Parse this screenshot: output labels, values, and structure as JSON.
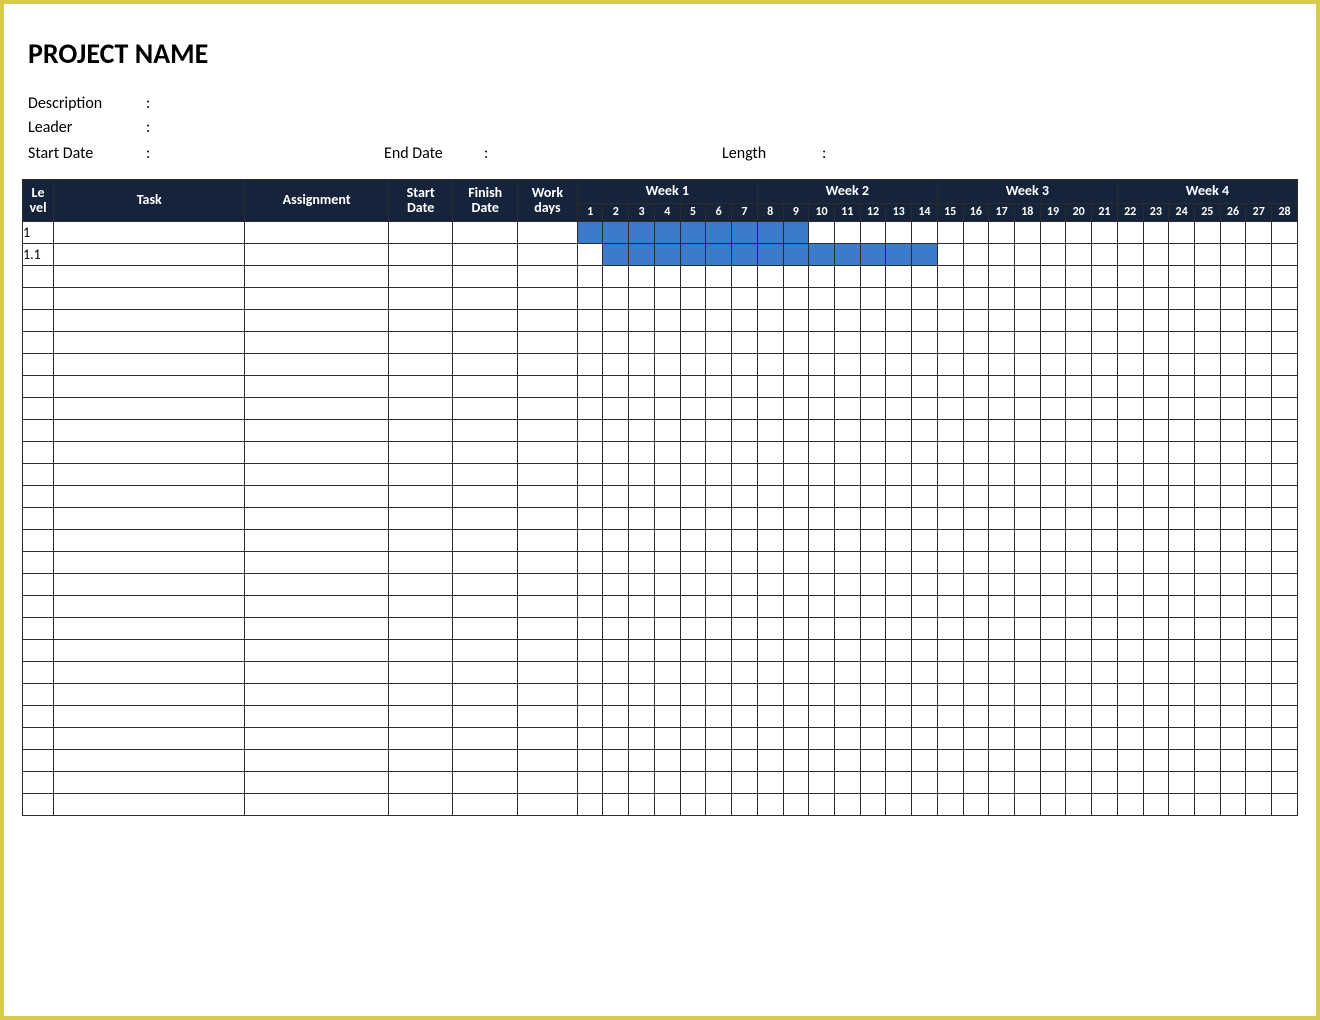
{
  "title": "PROJECT NAME",
  "meta": {
    "description_label": "Description",
    "leader_label": "Leader",
    "start_date_label": "Start Date",
    "end_date_label": "End Date",
    "length_label": "Length",
    "colon": ":"
  },
  "columns": {
    "level": "Le\nvel",
    "task": "Task",
    "assignment": "Assignment",
    "start_date": "Start\nDate",
    "finish_date": "Finish\nDate",
    "work_days": "Work\ndays",
    "weeks": [
      "Week 1",
      "Week 2",
      "Week 3",
      "Week 4"
    ],
    "days": [
      "1",
      "2",
      "3",
      "4",
      "5",
      "6",
      "7",
      "8",
      "9",
      "10",
      "11",
      "12",
      "13",
      "14",
      "15",
      "16",
      "17",
      "18",
      "19",
      "20",
      "21",
      "22",
      "23",
      "24",
      "25",
      "26",
      "27",
      "28"
    ]
  },
  "rows": [
    {
      "level": "1",
      "bar_start": 1,
      "bar_end": 9
    },
    {
      "level": "1.1",
      "bar_start": 2,
      "bar_end": 14
    },
    {},
    {},
    {},
    {},
    {},
    {},
    {},
    {},
    {},
    {},
    {},
    {},
    {},
    {},
    {},
    {},
    {},
    {},
    {},
    {},
    {},
    {},
    {},
    {},
    {}
  ],
  "chart_data": {
    "type": "gantt",
    "title": "PROJECT NAME",
    "x_unit": "day",
    "x_range": [
      1,
      28
    ],
    "groups": [
      "Week 1",
      "Week 2",
      "Week 3",
      "Week 4"
    ],
    "tasks": [
      {
        "level": "1",
        "start_day": 1,
        "end_day": 9
      },
      {
        "level": "1.1",
        "start_day": 2,
        "end_day": 14
      }
    ]
  }
}
